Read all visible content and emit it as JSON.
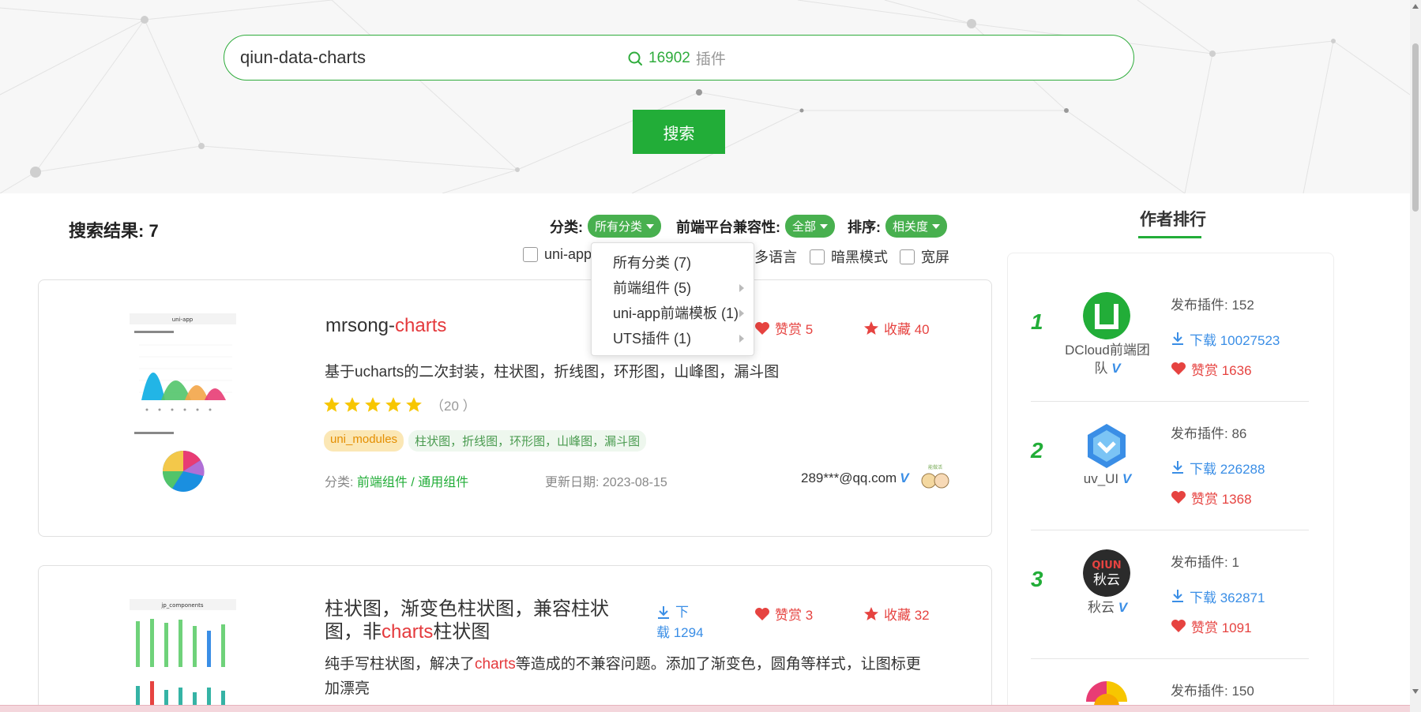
{
  "search": {
    "value": "qiun-data-charts",
    "count": "16902",
    "count_suffix": "插件",
    "button": "搜索"
  },
  "results": {
    "label": "搜索结果: 7"
  },
  "filters": {
    "category_label": "分类:",
    "category_value": "所有分类",
    "platform_label": "前端平台兼容性:",
    "platform_value": "全部",
    "sort_label": "排序:",
    "sort_value": "相关度"
  },
  "checkboxes": [
    "uni-app",
    "多语言",
    "暗黑模式",
    "宽屏"
  ],
  "dropdown": {
    "items": [
      "所有分类 (7)",
      "前端组件 (5)",
      "uni-app前端模板 (1)",
      "UTS插件 (1)"
    ]
  },
  "cards": [
    {
      "title_prefix": "mrsong-",
      "title_highlight": "charts",
      "like": "赞赏 5",
      "fav": "收藏 40",
      "desc": "基于ucharts的二次封装，柱状图，折线图，环形图，山峰图，漏斗图",
      "rating": 5,
      "rating_count": "（20 ）",
      "tag1": "uni_modules",
      "tag2": "柱状图，折线图，环形图，山峰图，漏斗图",
      "category_label": "分类:",
      "category_value": "前端组件 / 通用组件",
      "date": "更新日期: 2023-08-15",
      "author": "289***@qq.com",
      "badge": "能做活"
    },
    {
      "title_a": "柱状图，渐变色柱状图，兼容柱状",
      "title_b": "图，非",
      "title_highlight": "charts",
      "title_c": "柱状图",
      "download_a": "下",
      "download_b": "载 1294",
      "like": "赞赏 3",
      "fav": "收藏 32",
      "desc_a": "纯手写柱状图，解决了",
      "desc_highlight": "charts",
      "desc_b": "等造成的不兼容问题。添加了渐变色，圆角等样式，让图标更",
      "desc_c": "加漂亮"
    }
  ],
  "ranking": {
    "title": "作者排行",
    "rows": [
      {
        "rank": "1",
        "name_a": "DCloud前端团",
        "name_b": "队",
        "published": "发布插件: 152",
        "downloads": "下载 10027523",
        "likes": "赞赏 1636"
      },
      {
        "rank": "2",
        "name_a": "uv_UI",
        "name_b": "",
        "published": "发布插件: 86",
        "downloads": "下载 226288",
        "likes": "赞赏 1368"
      },
      {
        "rank": "3",
        "name_a": "秋云",
        "name_b": "",
        "published": "发布插件: 1",
        "downloads": "下载 362871",
        "likes": "赞赏 1091",
        "logo_top": "QIUN",
        "logo_bottom": "秋云"
      },
      {
        "rank": "",
        "name_a": "",
        "name_b": "",
        "published": "发布插件: 150"
      }
    ]
  },
  "thumbs": {
    "thumb1_title": "uni-app",
    "thumb2_title": "jp_components"
  },
  "colors": {
    "primary": "#22ad38",
    "highlight": "#e4393c",
    "download": "#3a8ee6",
    "like": "#e64340"
  }
}
